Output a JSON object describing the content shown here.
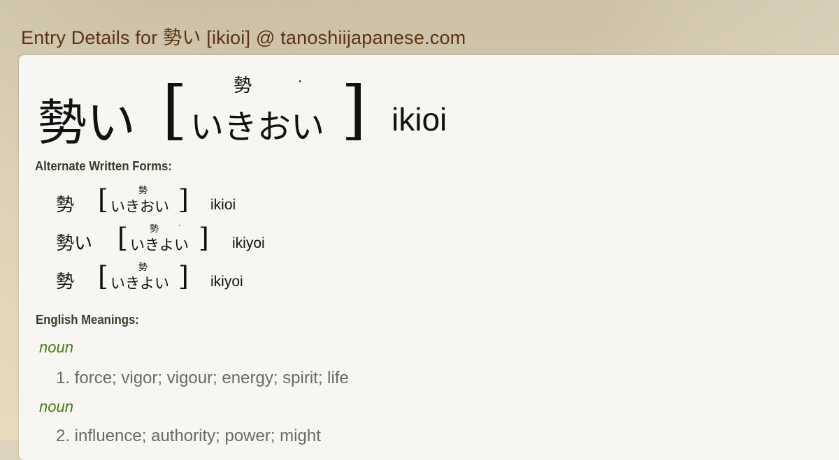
{
  "page": {
    "title": "Entry Details for 勢い [ikioi] @ tanoshiijapanese.com"
  },
  "entry": {
    "word": "勢い",
    "bracket_open": "[",
    "bracket_close": "]",
    "kana": "いきおい",
    "furigana": "勢",
    "accent_mark": "·",
    "romaji": "ikioi"
  },
  "alternate_forms": {
    "label": "Alternate Written Forms:",
    "items": [
      {
        "word": "勢",
        "kana": "いきおい",
        "furigana": "勢",
        "accent_mark": "",
        "romaji": "ikioi"
      },
      {
        "word": "勢い",
        "kana": "いきよい",
        "furigana": "勢",
        "accent_mark": "·",
        "romaji": "ikiyoi"
      },
      {
        "word": "勢",
        "kana": "いきよい",
        "furigana": "勢",
        "accent_mark": "",
        "romaji": "ikiyoi"
      }
    ]
  },
  "meanings": {
    "label": "English Meanings:",
    "items": [
      {
        "pos": "noun",
        "text": "1. force; vigor; vigour; energy; spirit; life"
      },
      {
        "pos": "noun",
        "text": "2. influence; authority; power; might"
      }
    ]
  }
}
